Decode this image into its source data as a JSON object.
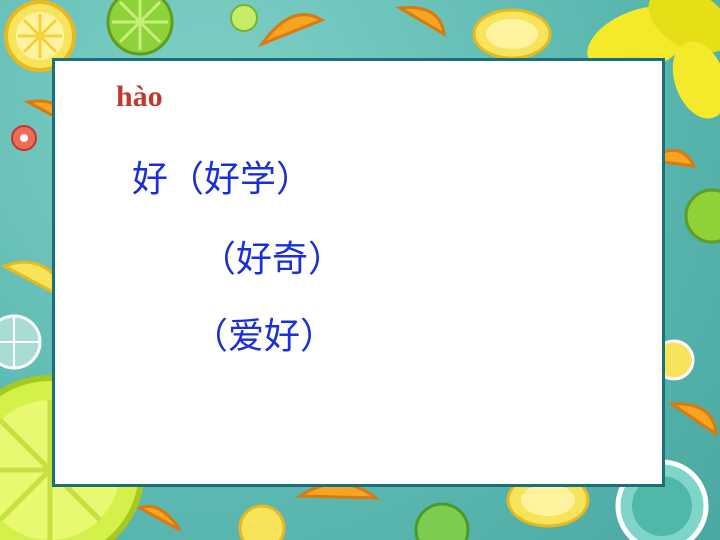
{
  "slide": {
    "pinyin": "hào",
    "lines": [
      "好（好学）",
      "（好奇）",
      "（爱好）"
    ]
  },
  "colors": {
    "border": "#5bb8b0",
    "frame": "#1a6f78",
    "pinyin": "#c0392b",
    "chinese_text": "#1a2fd6",
    "lemon": "#f5e03a",
    "orange": "#f39c12",
    "lime": "#8ed23a"
  }
}
